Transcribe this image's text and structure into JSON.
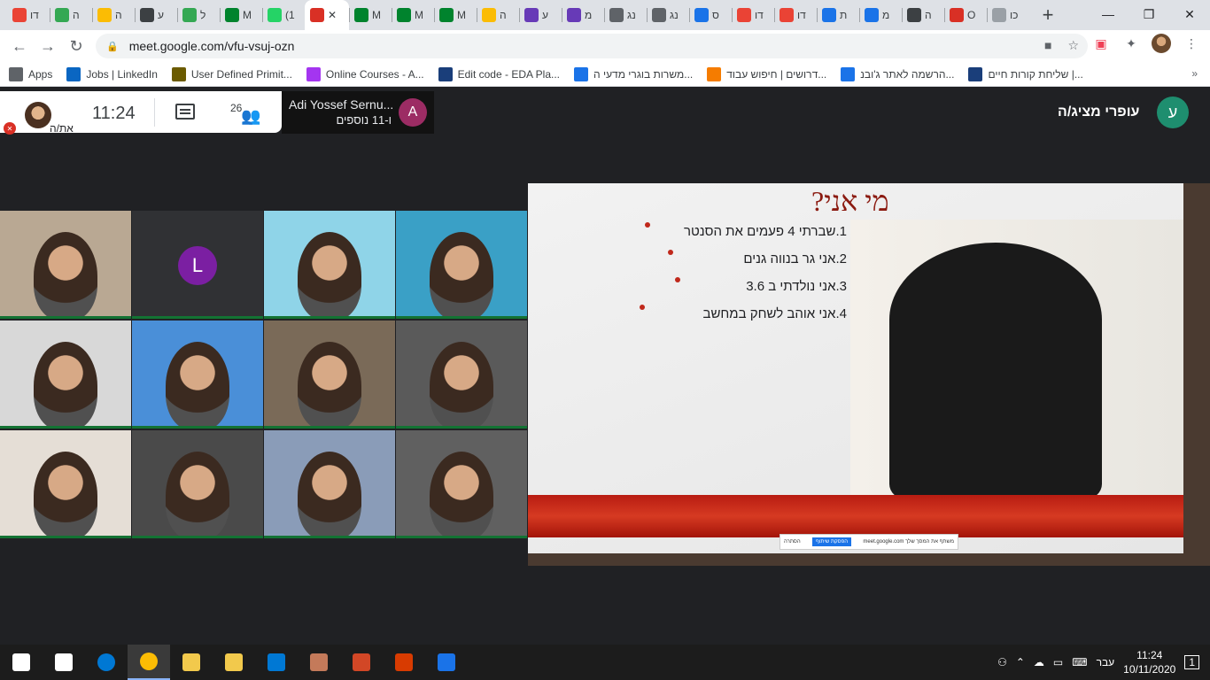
{
  "browser": {
    "tabs": [
      {
        "label": "דו",
        "icon": "gmail-icon",
        "color": "#ea4335"
      },
      {
        "label": "ה",
        "icon": "drive-icon",
        "color": "#34a853"
      },
      {
        "label": "ה",
        "icon": "drive-icon",
        "color": "#fbbc04"
      },
      {
        "label": "ע",
        "icon": "contacts-icon",
        "color": "#3c4043"
      },
      {
        "label": "ל",
        "icon": "drive-icon",
        "color": "#34a853"
      },
      {
        "label": "M",
        "icon": "meet-icon",
        "color": "#00832d"
      },
      {
        "label": "(1",
        "icon": "whatsapp-icon",
        "color": "#25d366"
      },
      {
        "label": "",
        "icon": "recording-icon",
        "color": "#d93025",
        "active": true
      },
      {
        "label": "M",
        "icon": "meet-icon",
        "color": "#00832d"
      },
      {
        "label": "M",
        "icon": "meet-icon",
        "color": "#00832d"
      },
      {
        "label": "M",
        "icon": "meet-icon",
        "color": "#00832d"
      },
      {
        "label": "ה",
        "icon": "drive-icon",
        "color": "#fbbc04"
      },
      {
        "label": "ע",
        "icon": "forms-icon",
        "color": "#673ab7"
      },
      {
        "label": "מ",
        "icon": "forms-icon",
        "color": "#673ab7"
      },
      {
        "label": "נג",
        "icon": "globe-icon",
        "color": "#5f6368"
      },
      {
        "label": "נג",
        "icon": "globe-icon",
        "color": "#5f6368"
      },
      {
        "label": "ס",
        "icon": "skype-icon",
        "color": "#1a73e8"
      },
      {
        "label": "דו",
        "icon": "gmail-icon",
        "color": "#ea4335"
      },
      {
        "label": "דו",
        "icon": "gmail-icon",
        "color": "#ea4335"
      },
      {
        "label": "ת",
        "icon": "classroom-icon",
        "color": "#1a73e8"
      },
      {
        "label": "מ",
        "icon": "chat-icon",
        "color": "#1a73e8"
      },
      {
        "label": "ה",
        "icon": "news-icon",
        "color": "#3c4043"
      },
      {
        "label": "O",
        "icon": "sway-icon",
        "color": "#d93025"
      },
      {
        "label": "כו",
        "icon": "doc-icon",
        "color": "#9aa0a6"
      }
    ],
    "close_tab": "✕",
    "new_tab": "+",
    "url": "meet.google.com/vfu-vsuj-ozn",
    "bookmarks": [
      {
        "label": "Apps",
        "icon": "apps-icon",
        "color": "#5f6368"
      },
      {
        "label": "Jobs | LinkedIn",
        "icon": "linkedin-icon",
        "color": "#0a66c2"
      },
      {
        "label": "User Defined Primit...",
        "icon": "bookmark-icon",
        "color": "#6b5b00"
      },
      {
        "label": "Online Courses - A...",
        "icon": "udemy-icon",
        "color": "#a435f0"
      },
      {
        "label": "Edit code - EDA Pla...",
        "icon": "eda-icon",
        "color": "#1a3e7a"
      },
      {
        "label": "משרות בוגרי מדעי ה...",
        "icon": "jobs-icon",
        "color": "#1a73e8"
      },
      {
        "label": "דרושים | חיפוש עבוד...",
        "icon": "jobs-icon",
        "color": "#f57c00"
      },
      {
        "label": "הרשמה לאתר ג'ובנ...",
        "icon": "jobs-icon",
        "color": "#1a73e8"
      },
      {
        "label": "שליחת קורות חיים |...",
        "icon": "jobs-icon",
        "color": "#1a3e7a"
      }
    ],
    "bookmarks_more": "»"
  },
  "meet": {
    "self_label": "את/ה",
    "time": "11:24",
    "participants_count": "26",
    "presenting_name": "Adi Yossef Sernu...",
    "presenting_more": "ו-11 נוספים",
    "presenting_initial": "A",
    "presenter_label": "עופרי מציג/ה",
    "presenter_initial": "ע",
    "tiles": [
      {
        "type": "video",
        "bg": "#b9a893"
      },
      {
        "type": "letter",
        "letter": "L",
        "bg": "#303134"
      },
      {
        "type": "video",
        "bg": "#8fd4e8"
      },
      {
        "type": "video",
        "bg": "#3aa0c6"
      },
      {
        "type": "video",
        "bg": "#d8d8d8"
      },
      {
        "type": "video",
        "bg": "#4a8fd8"
      },
      {
        "type": "video",
        "bg": "#7a6a58"
      },
      {
        "type": "video",
        "bg": "#5a5a5a"
      },
      {
        "type": "video",
        "bg": "#e5ded6"
      },
      {
        "type": "video",
        "bg": "#4a4a4a"
      },
      {
        "type": "video",
        "bg": "#8a9cb8"
      },
      {
        "type": "video",
        "bg": "#606060"
      }
    ]
  },
  "slide": {
    "title": "מי אני?",
    "bullets": [
      "1.שברתי 4 פעמים את הסנטר",
      "2.אני גר בנווה גנים",
      "3.אני נולדתי ב 3.6",
      "4.אני אוהב לשחק במחשב"
    ],
    "share_text": "meet.google.com משתף את המסך שלך",
    "share_stop": "הפסקת שיתוף",
    "share_hide": "הסתרה"
  },
  "taskbar": {
    "items": [
      {
        "icon": "windows-start-icon",
        "color": "#ffffff"
      },
      {
        "icon": "task-view-icon",
        "color": "#ffffff"
      },
      {
        "icon": "edge-icon",
        "color": "#0078d4"
      },
      {
        "icon": "chrome-icon",
        "color": "#fbbc04",
        "active": true
      },
      {
        "icon": "store-icon",
        "color": "#f2c94c"
      },
      {
        "icon": "explorer-icon",
        "color": "#f2c94c"
      },
      {
        "icon": "mail-icon",
        "color": "#0078d4"
      },
      {
        "icon": "paint-icon",
        "color": "#c47a5a"
      },
      {
        "icon": "powerpoint-icon",
        "color": "#d24726"
      },
      {
        "icon": "office-icon",
        "color": "#d83b01"
      },
      {
        "icon": "photos-icon",
        "color": "#1a73e8"
      }
    ],
    "language": "עבר",
    "time": "11:24",
    "date": "10/11/2020",
    "notifications": "1"
  }
}
